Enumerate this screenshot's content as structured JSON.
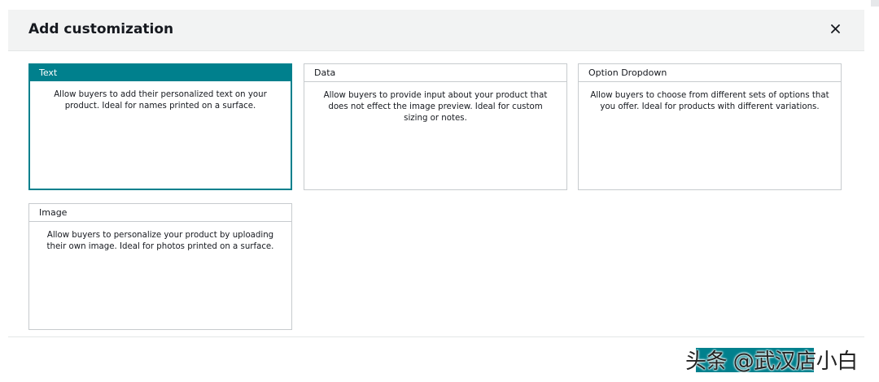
{
  "modal": {
    "title": "Add customization"
  },
  "cards": [
    {
      "id": "text",
      "title": "Text",
      "description": "Allow buyers to add their personalized text on your product. Ideal for names printed on a surface.",
      "selected": true
    },
    {
      "id": "data",
      "title": "Data",
      "description": "Allow buyers to provide input about your product that does not effect the image preview. Ideal for custom sizing or notes.",
      "selected": false
    },
    {
      "id": "option-dropdown",
      "title": "Option Dropdown",
      "description": "Allow buyers to choose from different sets of options that you offer. Ideal for products with different variations.",
      "selected": false
    },
    {
      "id": "image",
      "title": "Image",
      "description": "Allow buyers to personalize your product by uploading their own image. Ideal for photos printed on a surface.",
      "selected": false
    }
  ],
  "watermark": "头条 @武汉店小白",
  "colors": {
    "accent": "#00808d",
    "header_bg": "#f2f3f3",
    "border": "#c7cbce",
    "text": "#16191f"
  },
  "icons": {
    "close": "close-icon"
  }
}
